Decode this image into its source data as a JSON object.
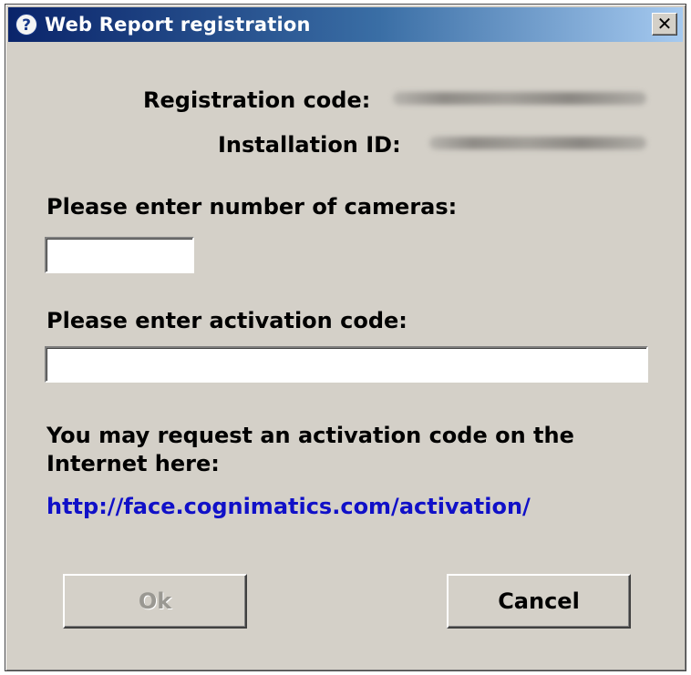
{
  "window": {
    "title": "Web Report registration",
    "title_icon": "question-icon",
    "close_label": "✕"
  },
  "registration": {
    "code_label": "Registration code:",
    "installation_label": "Installation ID:"
  },
  "cameras": {
    "label": "Please enter number of cameras:",
    "value": ""
  },
  "activation": {
    "label": "Please enter activation code:",
    "value": ""
  },
  "info": {
    "text": "You may request an activation code on the Internet here:",
    "link": "http://face.cognimatics.com/activation/"
  },
  "buttons": {
    "ok_label": "Ok",
    "cancel_label": "Cancel"
  },
  "colors": {
    "titlebar_start": "#0a246a",
    "titlebar_end": "#a6caf0",
    "dialog_face": "#d4d0c8",
    "link": "#1010c8"
  }
}
